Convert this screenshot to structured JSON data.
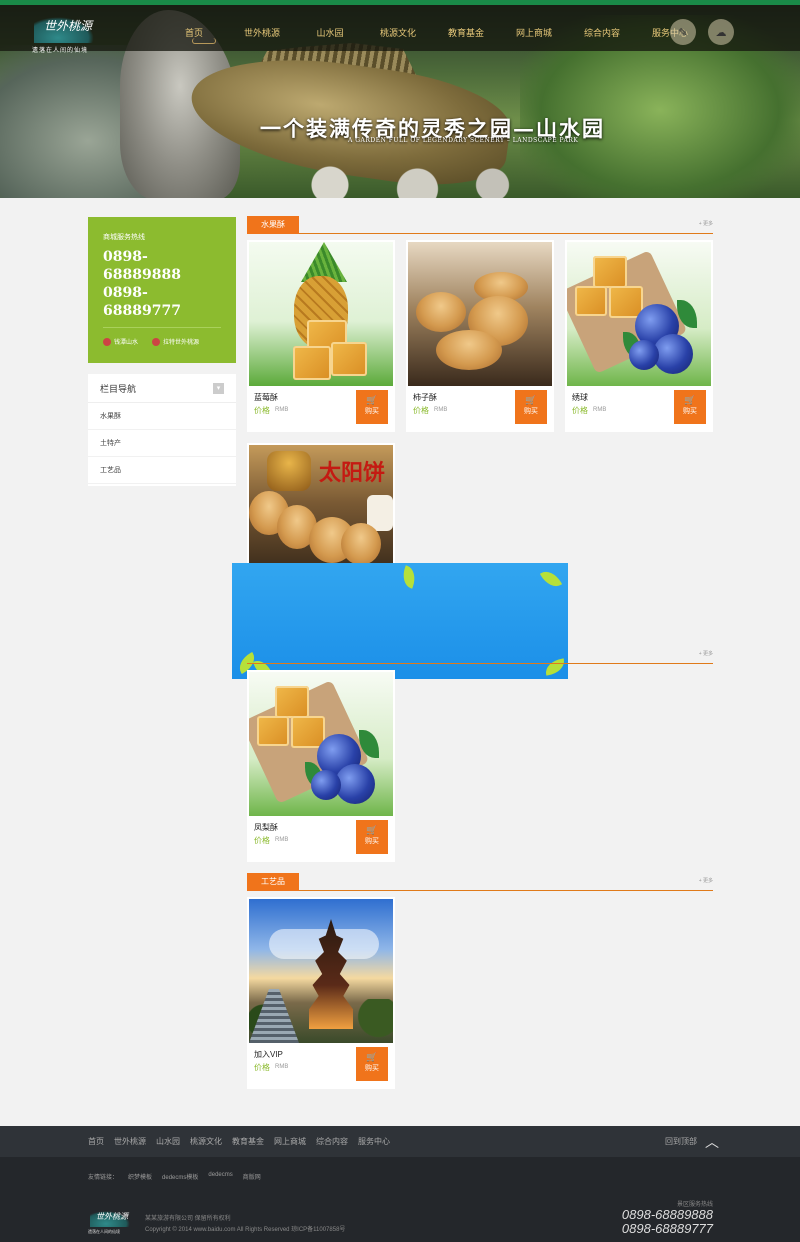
{
  "header": {
    "logo_cn": "世外桃源",
    "logo_tagline": "遗落在人间的仙境",
    "nav": [
      "首页",
      "世外桃源",
      "山水园",
      "桃源文化",
      "教育基金",
      "网上商城",
      "综合内容",
      "服务中心"
    ],
    "icons": [
      "weibo-icon",
      "wechat-icon"
    ]
  },
  "banner": {
    "slogan": "一个装满传奇的灵秀之园—山水园",
    "slogan_en": "A GARDEN FULL OF LEGENDARY SCENERY – LANDSCAPE PARK"
  },
  "sidebar": {
    "hotline_label": "商城服务热线",
    "phones": [
      "0898-68889888",
      "0898-68889777"
    ],
    "links": [
      "钱潭山水",
      "拉特世外桃源"
    ],
    "nav_title": "栏目导航",
    "nav_items": [
      "水果酥",
      "土特产",
      "工艺品"
    ]
  },
  "sections": [
    {
      "title": "水果酥",
      "more": "+ 更多",
      "products": [
        {
          "name": "蓝莓酥",
          "price_label": "价格",
          "currency": "RMB",
          "buy": "购买"
        },
        {
          "name": "柿子酥",
          "price_label": "价格",
          "currency": "RMB",
          "buy": "购买"
        },
        {
          "name": "绣球",
          "price_label": "价格",
          "currency": "RMB",
          "buy": "购买"
        },
        {
          "name": "",
          "price_label": "",
          "currency": "",
          "buy": ""
        }
      ]
    },
    {
      "title": "",
      "more": "+ 更多",
      "products": [
        {
          "name": "凤梨酥",
          "price_label": "价格",
          "currency": "RMB",
          "buy": "购买"
        }
      ]
    },
    {
      "title": "工艺品",
      "more": "+ 更多",
      "products": [
        {
          "name": "加入VIP",
          "price_label": "价格",
          "currency": "RMB",
          "buy": "购买"
        }
      ]
    }
  ],
  "sun_cake_text": "太阳饼",
  "footer": {
    "links": [
      "首页",
      "世外桃源",
      "山水园",
      "桃源文化",
      "教育基金",
      "网上商城",
      "综合内容",
      "服务中心"
    ],
    "back_top": "回到顶部",
    "friend_label": "友情链接：",
    "friends": [
      "织梦模板",
      "dedecms模板",
      "dedecms",
      "商版网"
    ],
    "logo_cn": "世外桃源",
    "logo_tagline": "遗落在人间的仙境",
    "company": "某某旅游有限公司    保留所有权利",
    "copyright": "Copyright © 2014 www.baidu.com All Rights Reserved 琼ICP备11007858号",
    "hotline_label": "景区服务热线",
    "phones": [
      "0898-68889888",
      "0898-68889777"
    ]
  },
  "colors": {
    "accent": "#f0741b",
    "green": "#8cbb2f",
    "topline": "#1a8a48",
    "overlay": "#1b8fe8"
  }
}
